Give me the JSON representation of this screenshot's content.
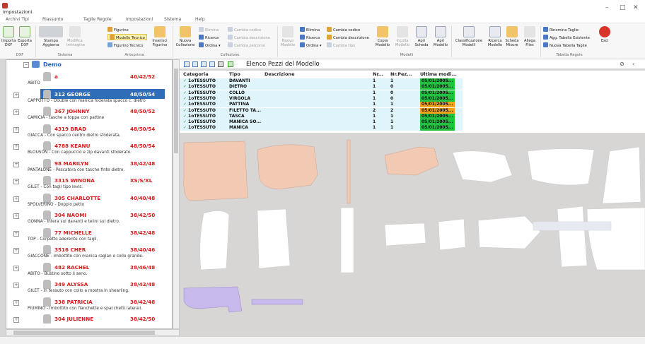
{
  "window": {
    "quick_access": "Impostazioni",
    "tabs": [
      "Archivi Tipi",
      "Riassunto",
      "Taglie Regole",
      "Impostazioni",
      "Sistema",
      "Help"
    ]
  },
  "ribbon": {
    "groups": [
      {
        "label": "DXF"
      },
      {
        "label": "Sistema"
      },
      {
        "label": "Anteprima"
      },
      {
        "label": "Collezione"
      },
      {
        "label": "Modelli"
      },
      {
        "label": "Tabella Regole"
      }
    ],
    "buttons": {
      "import_dxf": "Importa DXF",
      "export_dxf": "Esporta DXF",
      "print_update": "Stampa Aggiorna",
      "modify_image": "Modifica Immagine",
      "figurino": "Figurino",
      "modello_tecnico": "Modello Tecnico",
      "figurino_tecnico": "Figurino Tecnico",
      "insert_figurino": "Inserisci Figurino",
      "new_collection": "Nuova Collezione",
      "elimina_1": "Elimina",
      "cambia_codice_1": "Cambia codice",
      "ricerca_1": "Ricerca",
      "cambia_descrizione_1": "Cambia descrizione",
      "ordina_1": "Ordina",
      "cambia_percorso": "Cambia percorso",
      "new_model": "Nuovo Modello",
      "elimina_2": "Elimina",
      "cambia_codice_2": "Cambia codice",
      "ricerca_2": "Ricerca",
      "cambia_descrizione_2": "Cambia descrizione",
      "ordina_2": "Ordina",
      "cambia_tipo": "Cambia tipo",
      "copy_model": "Copia Modello",
      "paste_model": "Incolla Modello",
      "open_sheet": "Apri Scheda",
      "open_model": "Apri Modello",
      "classify_models": "Classificazione Modelli",
      "search_model": "Ricerca Modello",
      "size_chart": "Scheda Misure",
      "attach_files": "Allega Files",
      "rename_sizes": "Rinomina Taglie",
      "update_existing": "Agg. Tabella Esistente",
      "new_size_table": "Nuova Tabella Taglie",
      "exit": "Esci"
    }
  },
  "tree": {
    "root": "Demo",
    "items": [
      {
        "code": "a",
        "sizes": "40/42/52",
        "desc": "ABITO",
        "selected": false
      },
      {
        "code": "312 GEORGE",
        "sizes": "48/50/54",
        "desc": "CAPPOTTO - Double con manica foderata spacco c. dietro",
        "selected": true
      },
      {
        "code": "367 JOHNNY",
        "sizes": "48/50/52",
        "desc": "CAMICIA - tasche a toppa con pattine",
        "selected": false
      },
      {
        "code": "4319 BRAD",
        "sizes": "48/50/54",
        "desc": "GIACCA - Con spacco centro dietro sfoderata.",
        "selected": false
      },
      {
        "code": "4788 KEANU",
        "sizes": "48/50/54",
        "desc": "BLOUSON - Con cappuccio e zip davanti sfoderato.",
        "selected": false
      },
      {
        "code": "98 MARILYN",
        "sizes": "38/42/48",
        "desc": "PANTALONE - Pescatora con tasche finte dietro.",
        "selected": false
      },
      {
        "code": "3315 WINONA",
        "sizes": "XS/S/XL",
        "desc": "GILET - Con tagli tipo levis.",
        "selected": false
      },
      {
        "code": "305 CHARLOTTE",
        "sizes": "40/40/48",
        "desc": "SPOLVERINO - Doppio petto",
        "selected": false
      },
      {
        "code": "304 NAOMI",
        "sizes": "38/42/50",
        "desc": "GONNA - Intera sul davanti e telini sul dietro.",
        "selected": false
      },
      {
        "code": "77 MICHELLE",
        "sizes": "38/42/48",
        "desc": "TOP - Corpetto aderente con tagli.",
        "selected": false
      },
      {
        "code": "3516 CHER",
        "sizes": "38/40/46",
        "desc": "GIACCONE - Imbottito con manica raglan e collo grande.",
        "selected": false
      },
      {
        "code": "482 RACHEL",
        "sizes": "38/46/48",
        "desc": "ABITO - Bustino sotto il seno.",
        "selected": false
      },
      {
        "code": "349 ALYSSA",
        "sizes": "38/42/48",
        "desc": "GILET - In tessuto con collo a mostra in shearling.",
        "selected": false
      },
      {
        "code": "338 PATRICIA",
        "sizes": "38/42/48",
        "desc": "PIUMINO - Imbottito con fianchette e spacchetti laterali.",
        "selected": false
      },
      {
        "code": "304 JULIENNE",
        "sizes": "38/42/50",
        "desc": "",
        "selected": false
      }
    ]
  },
  "pieces_panel": {
    "title": "Elenco Pezzi del Modello",
    "columns": [
      "Categoria",
      "Tipo",
      "Descrizione",
      "Nr...",
      "Nr.Pez...",
      "Ultima modi..."
    ],
    "rows": [
      {
        "categoria": "1oTESSUTO",
        "tipo": "DAVANTI",
        "descrizione": "",
        "nr": "1",
        "nrpez": "1",
        "date": "05/01/2005...",
        "status": "green"
      },
      {
        "categoria": "1oTESSUTO",
        "tipo": "DIETRO",
        "descrizione": "",
        "nr": "1",
        "nrpez": "0",
        "date": "05/01/2005...",
        "status": "green"
      },
      {
        "categoria": "1oTESSUTO",
        "tipo": "COLLO",
        "descrizione": "",
        "nr": "1",
        "nrpez": "0",
        "date": "05/01/2005...",
        "status": "green"
      },
      {
        "categoria": "1oTESSUTO",
        "tipo": "VIRGOLA",
        "descrizione": "",
        "nr": "1",
        "nrpez": "0",
        "date": "05/01/2005...",
        "status": "green"
      },
      {
        "categoria": "1oTESSUTO",
        "tipo": "PATTINA",
        "descrizione": "",
        "nr": "1",
        "nrpez": "1",
        "date": "05/01/2005...",
        "status": "orange"
      },
      {
        "categoria": "1oTESSUTO",
        "tipo": "FILETTO TA...",
        "descrizione": "",
        "nr": "2",
        "nrpez": "2",
        "date": "05/01/2005...",
        "status": "orange"
      },
      {
        "categoria": "1oTESSUTO",
        "tipo": "TASCA",
        "descrizione": "",
        "nr": "1",
        "nrpez": "1",
        "date": "05/01/2005...",
        "status": "green"
      },
      {
        "categoria": "1oTESSUTO",
        "tipo": "MANICA SO...",
        "descrizione": "",
        "nr": "1",
        "nrpez": "1",
        "date": "05/01/2005...",
        "status": "green"
      },
      {
        "categoria": "1oTESSUTO",
        "tipo": "MANICA",
        "descrizione": "",
        "nr": "1",
        "nrpez": "1",
        "date": "05/01/2005...",
        "status": "green"
      }
    ]
  },
  "colors": {
    "selection": "#2f6db8",
    "code_red": "#d81b1b",
    "row_bg": "#dff4fb",
    "date_green": "#23c23f",
    "date_orange": "#f3a21b",
    "piece_peach": "#f2c9b2",
    "piece_lavender": "#c8b9ec"
  }
}
